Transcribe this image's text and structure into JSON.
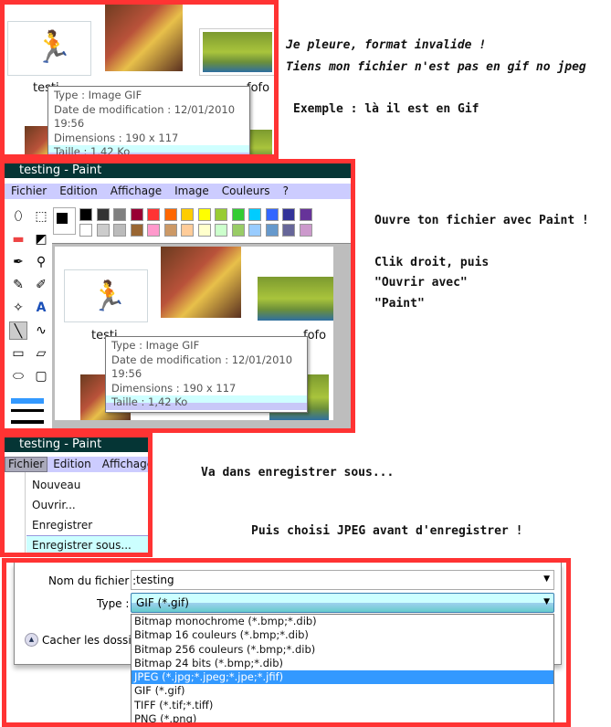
{
  "notes": {
    "n1": "Je pleure, format invalide !",
    "n2": "Tiens mon fichier n'est pas en gif no jpeg",
    "n3": "Exemple : là il est en Gif",
    "n4": "Ouvre ton fichier avec Paint !",
    "n5": "Clik droit, puis",
    "n6": "\"Ouvrir avec\"",
    "n7": "\"Paint\"",
    "n8": "Va dans enregistrer sous...",
    "n9": "Puis choisi JPEG avant d'enregistrer !"
  },
  "explorer": {
    "file1": "testi",
    "file3": "fofo",
    "tooltip": {
      "type": "Type : Image GIF",
      "date": "Date de modification : 12/01/2010 19:56",
      "dims": "Dimensions : 190 x 117",
      "size": "Taille : 1,42 Ko"
    }
  },
  "paint": {
    "title": "testing - Paint",
    "menu": [
      "Fichier",
      "Edition",
      "Affichage",
      "Image",
      "Couleurs",
      "?"
    ],
    "palette_top": [
      "#000000",
      "#333333",
      "#808080",
      "#990033",
      "#ff3333",
      "#ff6600",
      "#ffcc00",
      "#ffff00",
      "#99cc33",
      "#33cc33",
      "#00ccff",
      "#3366ff",
      "#333399",
      "#663399"
    ],
    "palette_bottom": [
      "#ffffff",
      "#cccccc",
      "#bbbbbb",
      "#996633",
      "#ff99cc",
      "#cc9966",
      "#ffcc99",
      "#ffffcc",
      "#ccffcc",
      "#99cc66",
      "#99ccff",
      "#6699cc",
      "#666699",
      "#cc99cc"
    ]
  },
  "file_menu": {
    "title": "testing - Paint",
    "menu": [
      "Fichier",
      "Edition",
      "Affichage"
    ],
    "items": [
      "Nouveau",
      "Ouvrir...",
      "Enregistrer",
      "Enregistrer sous..."
    ]
  },
  "save_dialog": {
    "filename_label": "Nom du fichier :",
    "filename": "testing",
    "type_label": "Type :",
    "type_value": "GIF (*.gif)",
    "hide_folders": "Cacher les dossier",
    "options": [
      "Bitmap monochrome (*.bmp;*.dib)",
      "Bitmap 16 couleurs (*.bmp;*.dib)",
      "Bitmap 256 couleurs (*.bmp;*.dib)",
      "Bitmap 24 bits (*.bmp;*.dib)",
      "JPEG (*.jpg;*.jpeg;*.jpe;*.jfif)",
      "GIF (*.gif)",
      "TIFF (*.tif;*.tiff)",
      "PNG (*.png)"
    ],
    "selected_option": "JPEG (*.jpg;*.jpeg;*.jpe;*.jfif)"
  }
}
